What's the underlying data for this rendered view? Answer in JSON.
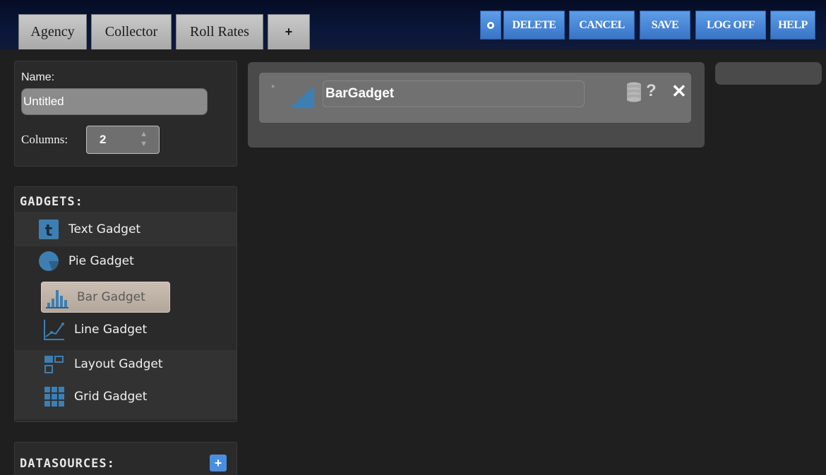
{
  "tabs": [
    {
      "label": "Agency"
    },
    {
      "label": "Collector"
    },
    {
      "label": "Roll Rates"
    },
    {
      "label": "+"
    }
  ],
  "toolbar": {
    "settings_icon": "gear-icon",
    "delete_label": "DELETE",
    "cancel_label": "CANCEL",
    "save_label": "SAVE",
    "logoff_label": "LOG OFF",
    "help_label": "HELP"
  },
  "properties": {
    "name_label": "Name:",
    "name_value": "Untitled",
    "columns_label": "Columns:",
    "columns_value": "2"
  },
  "gadgets": {
    "title": "GADGETS:",
    "items": [
      {
        "label": "Text Gadget",
        "icon": "text-gadget-icon"
      },
      {
        "label": "Pie Gadget",
        "icon": "pie-gadget-icon"
      },
      {
        "label": "Bar Gadget",
        "icon": "bar-gadget-icon",
        "selected": true
      },
      {
        "label": "Line Gadget",
        "icon": "line-gadget-icon"
      },
      {
        "label": "Layout Gadget",
        "icon": "layout-gadget-icon"
      },
      {
        "label": "Grid Gadget",
        "icon": "grid-gadget-icon"
      }
    ]
  },
  "datasources": {
    "title": "DATASOURCES:",
    "add_label": "+"
  },
  "canvas": {
    "gadget_title": "BarGadget",
    "help_label": "?",
    "close_label": "✕"
  },
  "colors": {
    "accent_button": "#3874c8",
    "tab_bg": "#b9b9b9",
    "panel_bg": "#2a2a2a",
    "selected_item": "#bfb3a7",
    "page_bg": "#1f1f1f"
  }
}
